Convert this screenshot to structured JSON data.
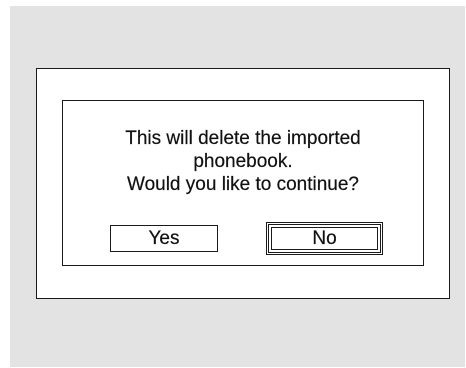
{
  "dialog": {
    "message_lines": [
      "This will delete the imported",
      "phonebook.",
      "Would you like to continue?"
    ],
    "buttons": {
      "yes_label": "Yes",
      "no_label": "No",
      "selected": "No"
    }
  }
}
